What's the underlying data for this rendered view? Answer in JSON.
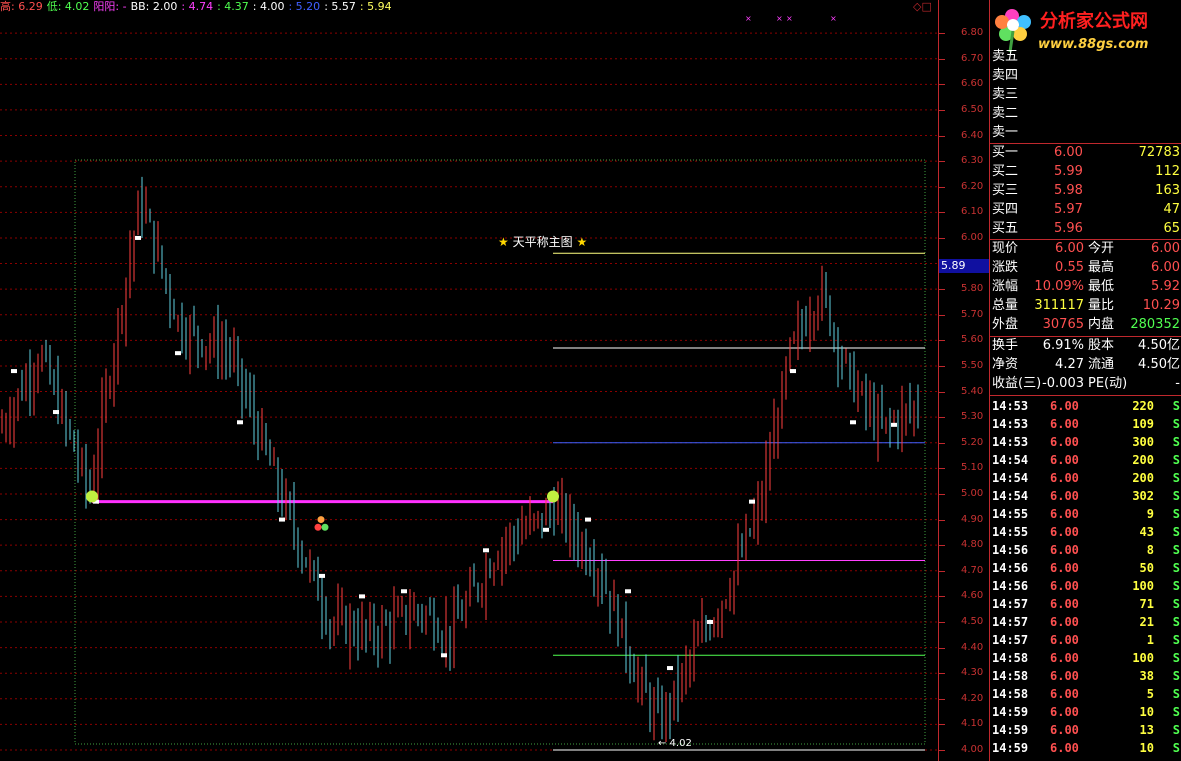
{
  "header": {
    "items": [
      {
        "label": "高: 6.29",
        "color": "#ff5050"
      },
      {
        "label": "低: 4.02",
        "color": "#50ff50"
      },
      {
        "label": "阳阳: -",
        "color": "#ff40ff"
      },
      {
        "label": "BB: 2.00",
        "color": "#ffffff"
      },
      {
        "label": ": 4.74",
        "color": "#ff40ff"
      },
      {
        "label": ": 4.37",
        "color": "#50ff50"
      },
      {
        "label": ": 4.00",
        "color": "#ffffff"
      },
      {
        "label": ": 5.20",
        "color": "#4060ff"
      },
      {
        "label": ": 5.57",
        "color": "#ffffff"
      },
      {
        "label": ": 5.94",
        "color": "#ffff60"
      }
    ],
    "window_controls": "◇□"
  },
  "chart_title": {
    "star_left": "★",
    "text": "天平称主图",
    "star_right": "★"
  },
  "min_label": "← 4.02",
  "current_price_tag": "5.89",
  "chart_data": {
    "type": "candlestick",
    "ylim": [
      4.0,
      6.85
    ],
    "y_ticks": [
      "6.80",
      "6.70",
      "6.60",
      "6.50",
      "6.40",
      "6.30",
      "6.20",
      "6.10",
      "6.00",
      "5.90",
      "5.80",
      "5.70",
      "5.60",
      "5.50",
      "5.40",
      "5.30",
      "5.20",
      "5.10",
      "5.00",
      "4.90",
      "4.80",
      "4.70",
      "4.60",
      "4.50",
      "4.40",
      "4.30",
      "4.20",
      "4.10",
      "4.00"
    ],
    "high": 6.29,
    "low": 4.02,
    "levels": [
      {
        "name": "5.94",
        "value": 5.94,
        "color": "#ffff80"
      },
      {
        "name": "5.57",
        "value": 5.57,
        "color": "#ffffff"
      },
      {
        "name": "5.20",
        "value": 5.2,
        "color": "#4060ff"
      },
      {
        "name": "4.74",
        "value": 4.74,
        "color": "#ff40ff"
      },
      {
        "name": "4.37",
        "value": 4.37,
        "color": "#50ff50"
      },
      {
        "name": "4.00",
        "value": 4.0,
        "color": "#ffffff"
      }
    ],
    "magenta_line": 4.97,
    "colors": {
      "up": "#ff4040",
      "down": "#60d0e0",
      "grid": "#8b0000",
      "box": "#40a040"
    }
  },
  "panel": {
    "sell_labels": [
      "卖五",
      "卖四",
      "卖三",
      "卖二",
      "卖一"
    ],
    "buy": [
      {
        "label": "买一",
        "price": "6.00",
        "vol": "72783"
      },
      {
        "label": "买二",
        "price": "5.99",
        "vol": "112"
      },
      {
        "label": "买三",
        "price": "5.98",
        "vol": "163"
      },
      {
        "label": "买四",
        "price": "5.97",
        "vol": "47"
      },
      {
        "label": "买五",
        "price": "5.96",
        "vol": "65"
      }
    ],
    "stats": [
      {
        "l1": "现价",
        "v1": "6.00",
        "c1": "#ff5050",
        "l2": "今开",
        "v2": "6.00",
        "c2": "#ff5050"
      },
      {
        "l1": "涨跌",
        "v1": "0.55",
        "c1": "#ff5050",
        "l2": "最高",
        "v2": "6.00",
        "c2": "#ff5050"
      },
      {
        "l1": "涨幅",
        "v1": "10.09%",
        "c1": "#ff5050",
        "l2": "最低",
        "v2": "5.92",
        "c2": "#ff5050"
      },
      {
        "l1": "总量",
        "v1": "311117",
        "c1": "#ffff40",
        "l2": "量比",
        "v2": "10.29",
        "c2": "#ff5050"
      },
      {
        "l1": "外盘",
        "v1": "30765",
        "c1": "#ff5050",
        "l2": "内盘",
        "v2": "280352",
        "c2": "#50ff50"
      }
    ],
    "finance": [
      {
        "l1": "换手",
        "v1": "6.91%",
        "l2": "股本",
        "v2": "4.50亿"
      },
      {
        "l1": "净资",
        "v1": "4.27",
        "l2": "流通",
        "v2": "4.50亿"
      },
      {
        "l1": "收益(三)",
        "v1": "-0.003",
        "l2": "PE(动)",
        "v2": "-"
      }
    ],
    "trades": [
      {
        "time": "14:53",
        "price": "6.00",
        "vol": "220",
        "side": "S"
      },
      {
        "time": "14:53",
        "price": "6.00",
        "vol": "109",
        "side": "S"
      },
      {
        "time": "14:53",
        "price": "6.00",
        "vol": "300",
        "side": "S"
      },
      {
        "time": "14:54",
        "price": "6.00",
        "vol": "200",
        "side": "S"
      },
      {
        "time": "14:54",
        "price": "6.00",
        "vol": "200",
        "side": "S"
      },
      {
        "time": "14:54",
        "price": "6.00",
        "vol": "302",
        "side": "S"
      },
      {
        "time": "14:55",
        "price": "6.00",
        "vol": "9",
        "side": "S"
      },
      {
        "time": "14:55",
        "price": "6.00",
        "vol": "43",
        "side": "S"
      },
      {
        "time": "14:56",
        "price": "6.00",
        "vol": "8",
        "side": "S"
      },
      {
        "time": "14:56",
        "price": "6.00",
        "vol": "50",
        "side": "S"
      },
      {
        "time": "14:56",
        "price": "6.00",
        "vol": "100",
        "side": "S"
      },
      {
        "time": "14:57",
        "price": "6.00",
        "vol": "71",
        "side": "S"
      },
      {
        "time": "14:57",
        "price": "6.00",
        "vol": "21",
        "side": "S"
      },
      {
        "time": "14:57",
        "price": "6.00",
        "vol": "1",
        "side": "S"
      },
      {
        "time": "14:58",
        "price": "6.00",
        "vol": "100",
        "side": "S"
      },
      {
        "time": "14:58",
        "price": "6.00",
        "vol": "38",
        "side": "S"
      },
      {
        "time": "14:58",
        "price": "6.00",
        "vol": "5",
        "side": "S"
      },
      {
        "time": "14:59",
        "price": "6.00",
        "vol": "10",
        "side": "S"
      },
      {
        "time": "14:59",
        "price": "6.00",
        "vol": "13",
        "side": "S"
      },
      {
        "time": "14:59",
        "price": "6.00",
        "vol": "10",
        "side": "S"
      }
    ]
  },
  "logo": {
    "title": "分析家公式网",
    "url": "www.88gs.com"
  }
}
